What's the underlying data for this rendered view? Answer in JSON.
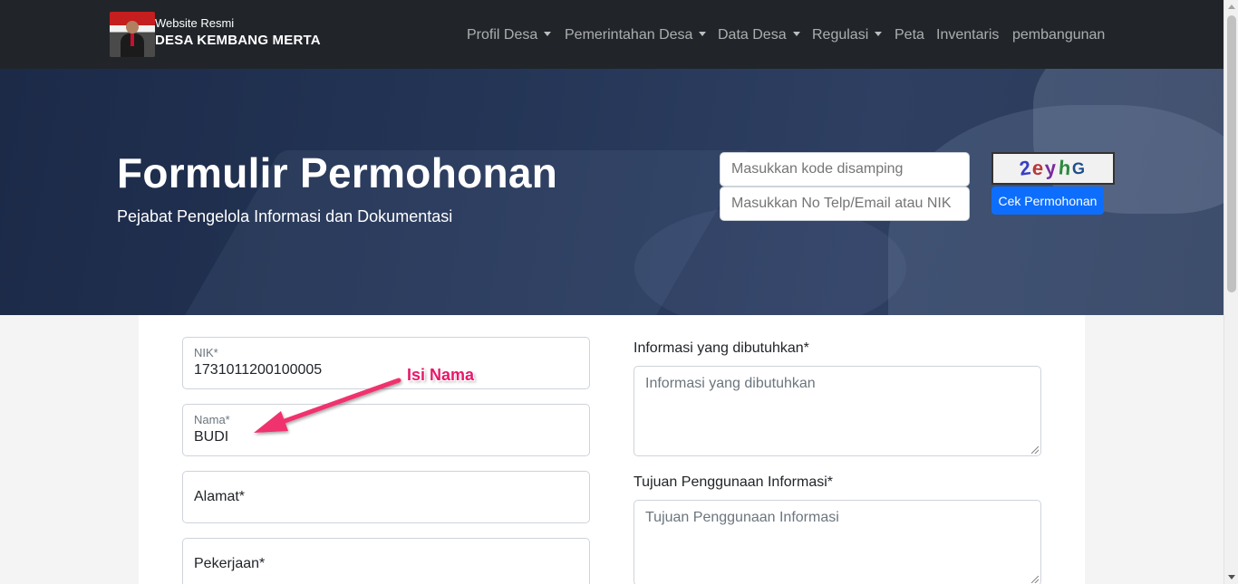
{
  "brand": {
    "small": "Website Resmi",
    "name": "DESA KEMBANG MERTA"
  },
  "nav": {
    "items": [
      {
        "label": "Profil Desa",
        "dropdown": true
      },
      {
        "label": "Pemerintahan Desa",
        "dropdown": true
      },
      {
        "label": "Data Desa",
        "dropdown": true
      },
      {
        "label": "Regulasi",
        "dropdown": true
      },
      {
        "label": "Peta",
        "dropdown": false
      },
      {
        "label": "Inventaris",
        "dropdown": false
      },
      {
        "label": "pembangunan",
        "dropdown": false
      }
    ]
  },
  "hero": {
    "title": "Formulir Permohonan",
    "subtitle": "Pejabat Pengelola Informasi dan Dokumentasi",
    "captcha_placeholder": "Masukkan kode disamping",
    "contact_placeholder": "Masukkan No Telp/Email atau NIK",
    "captcha_code": "2eyhG",
    "check_button": "Cek Permohonan"
  },
  "form": {
    "nik": {
      "label": "NIK*",
      "value": "1731011200100005"
    },
    "nama": {
      "label": "Nama*",
      "value": "BUDI"
    },
    "alamat": {
      "placeholder": "Alamat*"
    },
    "pekerjaan": {
      "placeholder": "Pekerjaan*"
    },
    "informasi": {
      "label": "Informasi yang dibutuhkan*",
      "placeholder": "Informasi yang dibutuhkan"
    },
    "tujuan": {
      "label": "Tujuan Penggunaan Informasi*",
      "placeholder": "Tujuan Penggunaan Informasi"
    }
  },
  "annotation": {
    "text": "Isi Nama",
    "color": "#e8176a"
  },
  "colors": {
    "navbar": "#212529",
    "primary": "#0d6efd"
  }
}
